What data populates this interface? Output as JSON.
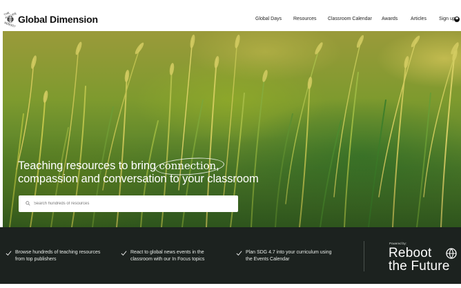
{
  "brand": {
    "name": "Global Dimension",
    "badge_top": "THE FUTURE",
    "badge_bottom": "REBOOT"
  },
  "nav": {
    "items": [
      {
        "label": "Global Days"
      },
      {
        "label": "Resources"
      },
      {
        "label": "Classroom Calendar"
      },
      {
        "label": "Awards"
      },
      {
        "label": "Articles"
      }
    ],
    "signup_label": "Sign up"
  },
  "hero": {
    "headline_part1": "Teaching resources to bring ",
    "headline_emphasis": "connection",
    "headline_part2": ",",
    "headline_line2": "compassion and conversation to your classroom",
    "search_placeholder": "Search hundreds of resources",
    "search_value": ""
  },
  "features": [
    {
      "line1": "Browse hundreds of teaching resources",
      "line2": "from top publishers"
    },
    {
      "line1": "React to global news events in the",
      "line2": "classroom with our In Focus topics"
    },
    {
      "line1": "Plan SDG 4.7 into your curriculum using",
      "line2": "the Events Calendar"
    }
  ],
  "powered": {
    "label": "Powered by:",
    "line1": "Reboot",
    "line2": "the Future"
  },
  "colors": {
    "band": "#1c221f",
    "header_bg": "#ffffff",
    "text_dark": "#111111"
  }
}
